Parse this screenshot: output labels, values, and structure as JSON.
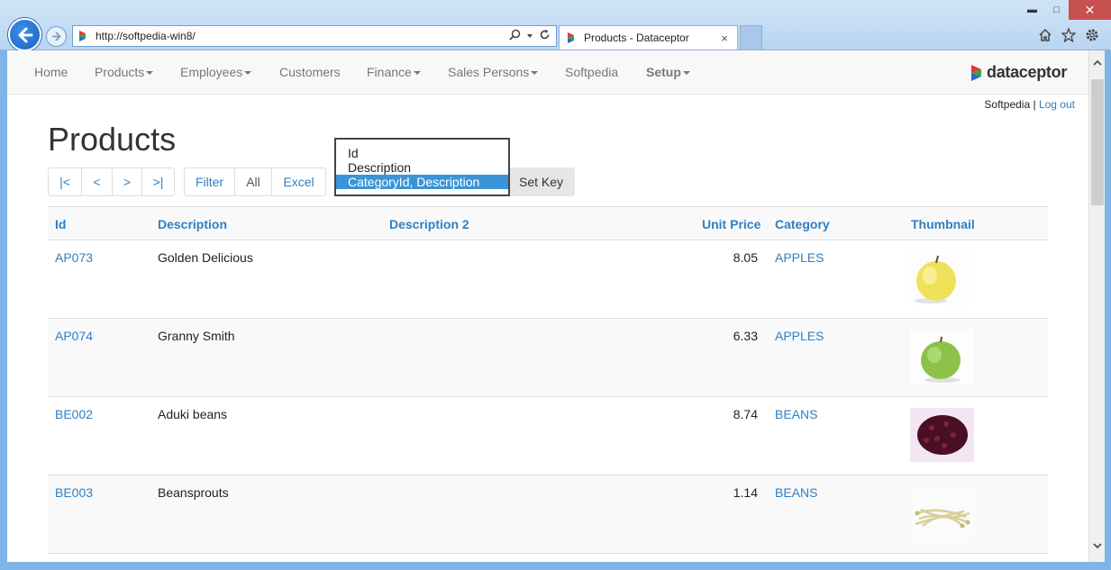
{
  "browser": {
    "url": "http://softpedia-win8/",
    "tab_title": "Products - Dataceptor",
    "tab_close": "×",
    "window_controls": {
      "minimize": "▬",
      "maximize": "□",
      "close": "✕"
    }
  },
  "navbar": {
    "items": [
      {
        "label": "Home",
        "dropdown": false
      },
      {
        "label": "Products",
        "dropdown": true
      },
      {
        "label": "Employees",
        "dropdown": true
      },
      {
        "label": "Customers",
        "dropdown": false
      },
      {
        "label": "Finance",
        "dropdown": true
      },
      {
        "label": "Sales Persons",
        "dropdown": true
      },
      {
        "label": "Softpedia",
        "dropdown": false
      },
      {
        "label": "Setup",
        "dropdown": true
      }
    ],
    "brand": "dataceptor"
  },
  "user": {
    "name": "Softpedia",
    "separator": "|",
    "logout": "Log out"
  },
  "page": {
    "title": "Products"
  },
  "pager": {
    "first": "|<",
    "prev": "<",
    "next": ">",
    "last": ">|"
  },
  "actions": {
    "filter": "Filter",
    "all": "All",
    "excel": "Excel"
  },
  "sort_key": {
    "options": [
      "Id",
      "Description",
      "CategoryId, Description"
    ],
    "selected_index": 2,
    "set_key_label": "Set Key"
  },
  "table": {
    "headers": [
      "Id",
      "Description",
      "Description 2",
      "Unit Price",
      "Category",
      "Thumbnail"
    ],
    "rows": [
      {
        "id": "AP073",
        "description": "Golden Delicious",
        "description2": "",
        "unit_price": "8.05",
        "category": "APPLES",
        "thumbnail": "yellow-apple"
      },
      {
        "id": "AP074",
        "description": "Granny Smith",
        "description2": "",
        "unit_price": "6.33",
        "category": "APPLES",
        "thumbnail": "green-apple"
      },
      {
        "id": "BE002",
        "description": "Aduki beans",
        "description2": "",
        "unit_price": "8.74",
        "category": "BEANS",
        "thumbnail": "red-beans"
      },
      {
        "id": "BE003",
        "description": "Beansprouts",
        "description2": "",
        "unit_price": "1.14",
        "category": "BEANS",
        "thumbnail": "beansprouts"
      }
    ]
  },
  "colors": {
    "link": "#2f7fc4",
    "selected": "#3a94d8",
    "navbar_bg": "#f8f8f8"
  }
}
